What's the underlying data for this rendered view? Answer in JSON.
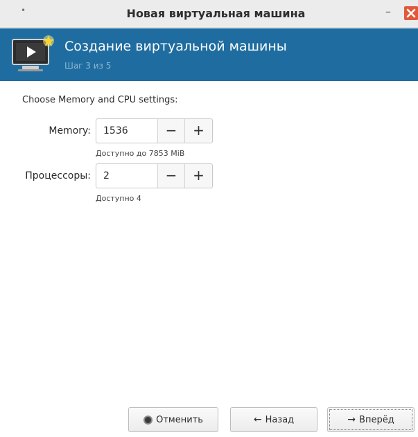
{
  "window": {
    "title": "Новая виртуальная машина",
    "menu_dot": "•",
    "minimize": "–"
  },
  "banner": {
    "title": "Создание виртуальной машины",
    "step": "Шаг 3 из 5",
    "icon": "monitor-play-icon",
    "background_color": "#1f6da0"
  },
  "content": {
    "section_title": "Choose Memory and CPU settings:",
    "memory": {
      "label": "Memory:",
      "value": "1536",
      "hint": "Доступно до 7853 MiB",
      "minus": "−",
      "plus": "+"
    },
    "cpus": {
      "label": "Процессоры:",
      "value": "2",
      "hint": "Доступно 4",
      "minus": "−",
      "plus": "+"
    }
  },
  "buttons": {
    "cancel": {
      "label": "Отменить",
      "icon": "stop-circle-icon"
    },
    "back": {
      "label": "Назад",
      "icon": "←"
    },
    "forward": {
      "label": "Вперёд",
      "icon": "→"
    }
  },
  "colors": {
    "close_button": "#e0593a",
    "banner_step_text": "#8fb6d2"
  }
}
